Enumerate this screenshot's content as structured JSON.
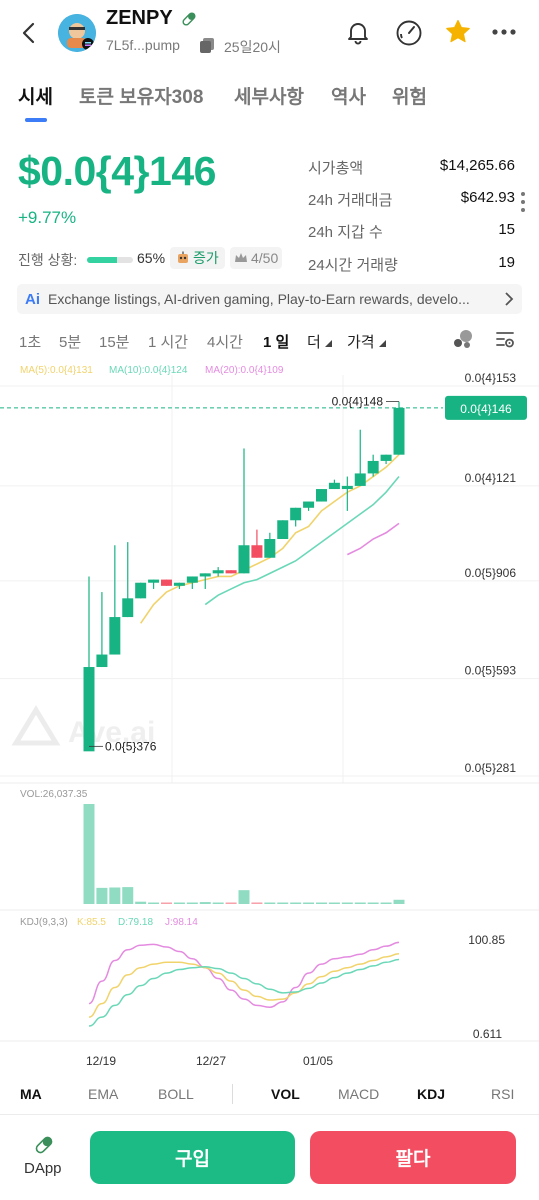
{
  "header": {
    "token_name": "ZENPY",
    "address": "7L5f...pump",
    "age": "25일20시"
  },
  "tabs": [
    {
      "label": "시세"
    },
    {
      "label": "토큰 보유자308"
    },
    {
      "label": "세부사항"
    },
    {
      "label": "역사"
    },
    {
      "label": "위험"
    }
  ],
  "price": {
    "value": "$0.0{4}146",
    "change": "+9.77%"
  },
  "stats": [
    {
      "label": "시가총액",
      "value": "$14,265.66"
    },
    {
      "label": "24h 거래대금",
      "value": "$642.93"
    },
    {
      "label": "24h 지갑 수",
      "value": "15"
    },
    {
      "label": "24시간 거래량",
      "value": "19"
    }
  ],
  "progress": {
    "label": "진행 상황:",
    "percent_text": "65%",
    "fraction": 0.65,
    "status": "증가",
    "rank": "4/50"
  },
  "ai_summary": {
    "tag": "Ai",
    "text": "Exchange listings, AI-driven gaming, Play-to-Earn rewards, develo..."
  },
  "timeframes": [
    {
      "label": "1초"
    },
    {
      "label": "5분"
    },
    {
      "label": "15분"
    },
    {
      "label": "1 시간"
    },
    {
      "label": "4시간"
    },
    {
      "label": "1 일"
    },
    {
      "label": "더"
    },
    {
      "label": "가격"
    }
  ],
  "indicators": [
    {
      "label": "MA"
    },
    {
      "label": "EMA"
    },
    {
      "label": "BOLL"
    },
    {
      "label": "VOL"
    },
    {
      "label": "MACD"
    },
    {
      "label": "KDJ"
    },
    {
      "label": "RSI"
    }
  ],
  "footer": {
    "dapp_label": "DApp",
    "buy_label": "구입",
    "sell_label": "팔다"
  },
  "colors": {
    "up": "#18b383",
    "down": "#f24d60",
    "ma5": "#f1d36b",
    "ma10": "#6ad8b8",
    "ma20": "#e48be0",
    "accent": "#3c7cf6"
  },
  "chart_data": {
    "type": "candlestick",
    "legend": {
      "ma5": "MA(5):0.0{4}131",
      "ma10": "MA(10):0.0{4}124",
      "ma20": "MA(20):0.0{4}109"
    },
    "y_tick_labels": [
      "0.0{4}153",
      "0.0{4}121",
      "0.0{5}906",
      "0.0{5}593",
      "0.0{5}281"
    ],
    "y_ticks": [
      1.53e-05,
      1.21e-05,
      9.06e-06,
      5.93e-06,
      2.81e-06
    ],
    "ylim": [
      2.81e-06,
      1.53e-05
    ],
    "current_price_label": "0.0{4}146",
    "current_price": 1.46e-05,
    "high_label": "0.0{4}148",
    "low_label": "0.0{5}376",
    "x_tick_labels": [
      "12/19",
      "12/27",
      "01/05"
    ],
    "watermark": "Ave.ai",
    "candles": [
      {
        "o": 3.6e-06,
        "h": 9.2e-06,
        "l": 3.76e-06,
        "c": 6.3e-06
      },
      {
        "o": 6.3e-06,
        "h": 8.7e-06,
        "l": 6.3e-06,
        "c": 6.7e-06
      },
      {
        "o": 6.7e-06,
        "h": 1.02e-05,
        "l": 6.7e-06,
        "c": 7.9e-06
      },
      {
        "o": 7.9e-06,
        "h": 1.03e-05,
        "l": 7.9e-06,
        "c": 8.5e-06
      },
      {
        "o": 8.5e-06,
        "h": 9e-06,
        "l": 8.5e-06,
        "c": 9e-06
      },
      {
        "o": 9e-06,
        "h": 9.1e-06,
        "l": 8.8e-06,
        "c": 9.1e-06
      },
      {
        "o": 9.1e-06,
        "h": 9.1e-06,
        "l": 8.9e-06,
        "c": 8.9e-06
      },
      {
        "o": 8.9e-06,
        "h": 9e-06,
        "l": 8.8e-06,
        "c": 9e-06
      },
      {
        "o": 9e-06,
        "h": 9.2e-06,
        "l": 8.8e-06,
        "c": 9.2e-06
      },
      {
        "o": 9.2e-06,
        "h": 9.3e-06,
        "l": 8.8e-06,
        "c": 9.3e-06
      },
      {
        "o": 9.3e-06,
        "h": 9.5e-06,
        "l": 9.2e-06,
        "c": 9.4e-06
      },
      {
        "o": 9.4e-06,
        "h": 9.4e-06,
        "l": 9.3e-06,
        "c": 9.3e-06
      },
      {
        "o": 9.3e-06,
        "h": 1.33e-05,
        "l": 9.3e-06,
        "c": 1.02e-05
      },
      {
        "o": 1.02e-05,
        "h": 1.07e-05,
        "l": 9.8e-06,
        "c": 9.8e-06
      },
      {
        "o": 9.8e-06,
        "h": 1.06e-05,
        "l": 9.8e-06,
        "c": 1.04e-05
      },
      {
        "o": 1.04e-05,
        "h": 1.1e-05,
        "l": 1.04e-05,
        "c": 1.1e-05
      },
      {
        "o": 1.1e-05,
        "h": 1.14e-05,
        "l": 1.08e-05,
        "c": 1.14e-05
      },
      {
        "o": 1.14e-05,
        "h": 1.16e-05,
        "l": 1.13e-05,
        "c": 1.16e-05
      },
      {
        "o": 1.16e-05,
        "h": 1.2e-05,
        "l": 1.16e-05,
        "c": 1.2e-05
      },
      {
        "o": 1.2e-05,
        "h": 1.23e-05,
        "l": 1.2e-05,
        "c": 1.22e-05
      },
      {
        "o": 1.2e-05,
        "h": 1.24e-05,
        "l": 1.13e-05,
        "c": 1.21e-05
      },
      {
        "o": 1.21e-05,
        "h": 1.39e-05,
        "l": 1.21e-05,
        "c": 1.25e-05
      },
      {
        "o": 1.25e-05,
        "h": 1.31e-05,
        "l": 1.24e-05,
        "c": 1.29e-05
      },
      {
        "o": 1.29e-05,
        "h": 1.31e-05,
        "l": 1.28e-05,
        "c": 1.31e-05
      },
      {
        "o": 1.31e-05,
        "h": 1.48e-05,
        "l": 1.31e-05,
        "c": 1.46e-05
      }
    ],
    "ma5": [
      null,
      null,
      null,
      null,
      7.7e-06,
      8.3e-06,
      8.7e-06,
      8.9e-06,
      9e-06,
      9.1e-06,
      9.2e-06,
      9.2e-06,
      9.4e-06,
      9.6e-06,
      9.8e-06,
      1.01e-05,
      1.06e-05,
      1.08e-05,
      1.13e-05,
      1.16e-05,
      1.19e-05,
      1.21e-05,
      1.24e-05,
      1.27e-05,
      1.31e-05
    ],
    "ma10": [
      null,
      null,
      null,
      null,
      null,
      null,
      null,
      null,
      null,
      8.3e-06,
      8.6e-06,
      8.8e-06,
      9e-06,
      9.1e-06,
      9.3e-06,
      9.5e-06,
      9.7e-06,
      1e-05,
      1.03e-05,
      1.06e-05,
      1.09e-05,
      1.12e-05,
      1.15e-05,
      1.19e-05,
      1.24e-05
    ],
    "ma20": [
      null,
      null,
      null,
      null,
      null,
      null,
      null,
      null,
      null,
      null,
      null,
      null,
      null,
      null,
      null,
      null,
      null,
      null,
      null,
      null,
      9.9e-06,
      1.01e-05,
      1.04e-05,
      1.06e-05,
      1.09e-05
    ],
    "volume_label": "VOL:26,037.35",
    "volumes": [
      26037,
      4200,
      4300,
      4400,
      600,
      250,
      200,
      180,
      300,
      500,
      350,
      200,
      3600,
      400,
      350,
      300,
      250,
      220,
      200,
      190,
      180,
      200,
      250,
      300,
      1100
    ],
    "kdj_label": "KDJ(9,3,3)",
    "kdj_k_label": "K:85.5",
    "kdj_d_label": "D:79.18",
    "kdj_j_label": "J:98.14",
    "kdj_tick_labels": [
      "100.85",
      "0.611"
    ],
    "kdj_ylim": [
      0.611,
      100.85
    ],
    "k": [
      15,
      30,
      48,
      62,
      70,
      74,
      76,
      76,
      74,
      70,
      64,
      55,
      45,
      38,
      34,
      35,
      42,
      52,
      60,
      66,
      70,
      74,
      78,
      82,
      85.5
    ],
    "d": [
      5,
      15,
      28,
      40,
      50,
      58,
      64,
      68,
      70,
      71,
      69,
      64,
      58,
      52,
      46,
      42,
      43,
      47,
      53,
      59,
      64,
      68,
      72,
      76,
      79.18
    ],
    "j": [
      30,
      55,
      78,
      90,
      95,
      96,
      93,
      88,
      80,
      70,
      58,
      45,
      35,
      28,
      26,
      32,
      48,
      64,
      74,
      80,
      82,
      85,
      90,
      94,
      98.14
    ]
  }
}
